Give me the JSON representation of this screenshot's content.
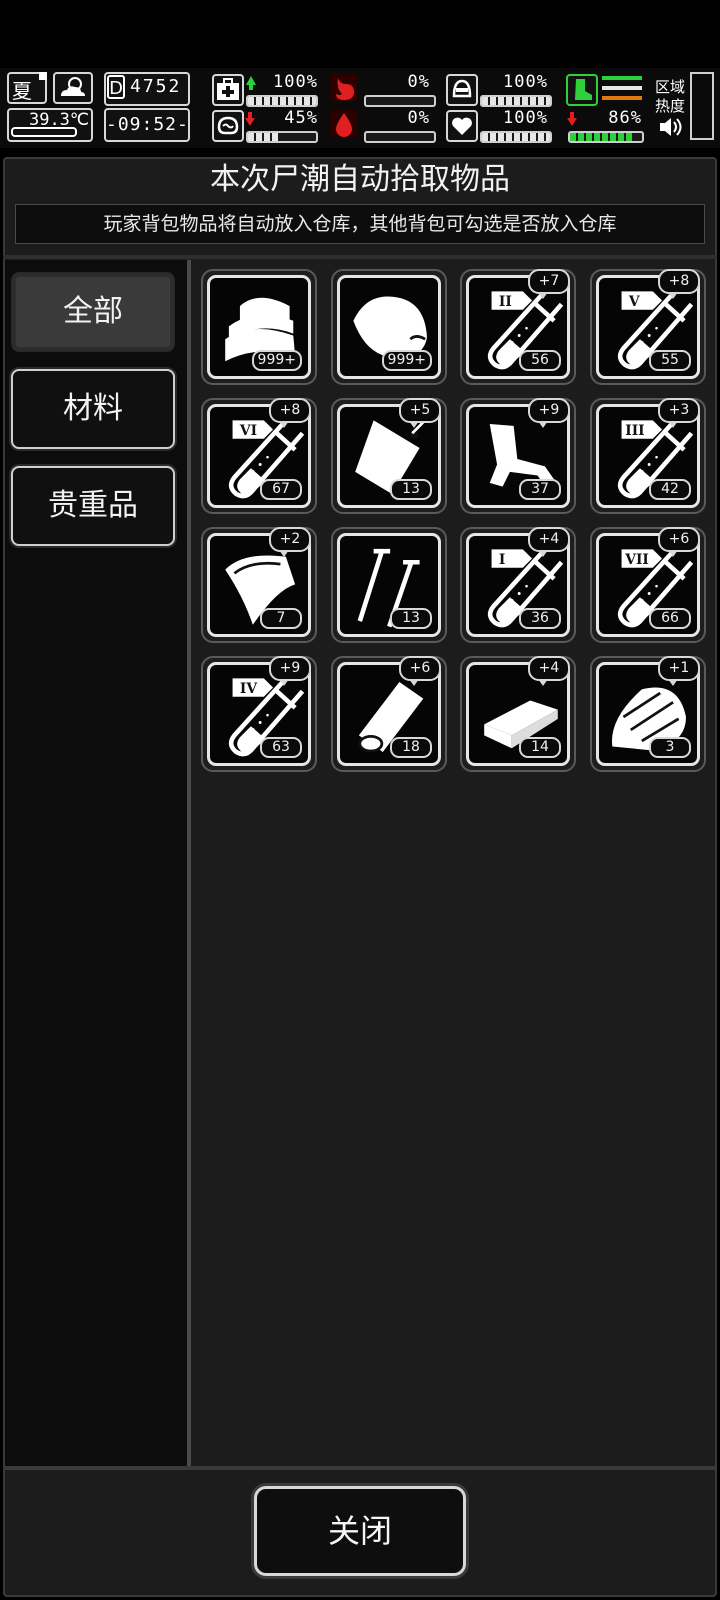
{
  "hud": {
    "season": "夏",
    "temperature": "39.3℃",
    "day_counter": "4752",
    "day_prefix": "D",
    "clock": "-09:52-",
    "health_pct": "100%",
    "health_level": 1.0,
    "mood_pct": "45%",
    "mood_level": 0.45,
    "hunger_pct": "0%",
    "hunger_level": 0,
    "thirst_pct": "0%",
    "thirst_level": 0,
    "armor_pct": "100%",
    "armor_level": 1.0,
    "heart_pct": "100%",
    "heart_level": 1.0,
    "stamina_pct": "86%",
    "stamina_level": 0.86,
    "zone_heat_label": "区域热度",
    "colors": {
      "up_arrow": "#2bd13a",
      "down_arrow": "#e02020",
      "stamina": "#2fd13a",
      "orange": "#e07a10"
    }
  },
  "dialog": {
    "title": "本次尸潮自动拾取物品",
    "subtitle": "玩家背包物品将自动放入仓库，其他背包可勾选是否放入仓库",
    "close_label": "关闭"
  },
  "tabs": [
    {
      "label": "全部",
      "active": true
    },
    {
      "label": "材料",
      "active": false
    },
    {
      "label": "贵重品",
      "active": false
    }
  ],
  "items": [
    {
      "icon": "cloth-icon",
      "count": "999+",
      "plus": ""
    },
    {
      "icon": "meat-icon",
      "count": "999+",
      "plus": ""
    },
    {
      "icon": "test-tube-ii-icon",
      "numeral": "II",
      "count": "56",
      "plus": "+7"
    },
    {
      "icon": "test-tube-v-icon",
      "numeral": "V",
      "count": "55",
      "plus": "+8"
    },
    {
      "icon": "test-tube-vi-icon",
      "numeral": "VI",
      "count": "67",
      "plus": "+8"
    },
    {
      "icon": "bag-icon",
      "count": "13",
      "plus": "+5"
    },
    {
      "icon": "scrap-metal-icon",
      "count": "37",
      "plus": "+9"
    },
    {
      "icon": "test-tube-iii-icon",
      "numeral": "III",
      "count": "42",
      "plus": "+3"
    },
    {
      "icon": "leather-icon",
      "count": "7",
      "plus": "+2"
    },
    {
      "icon": "nails-icon",
      "count": "13",
      "plus": ""
    },
    {
      "icon": "test-tube-i-icon",
      "numeral": "I",
      "count": "36",
      "plus": "+4"
    },
    {
      "icon": "test-tube-vii-icon",
      "numeral": "VII",
      "count": "66",
      "plus": "+6"
    },
    {
      "icon": "test-tube-iv-icon",
      "numeral": "IV",
      "count": "63",
      "plus": "+9"
    },
    {
      "icon": "log-icon",
      "count": "18",
      "plus": "+6"
    },
    {
      "icon": "plank-icon",
      "count": "14",
      "plus": "+4"
    },
    {
      "icon": "wood-chips-icon",
      "count": "3",
      "plus": "+1"
    }
  ]
}
